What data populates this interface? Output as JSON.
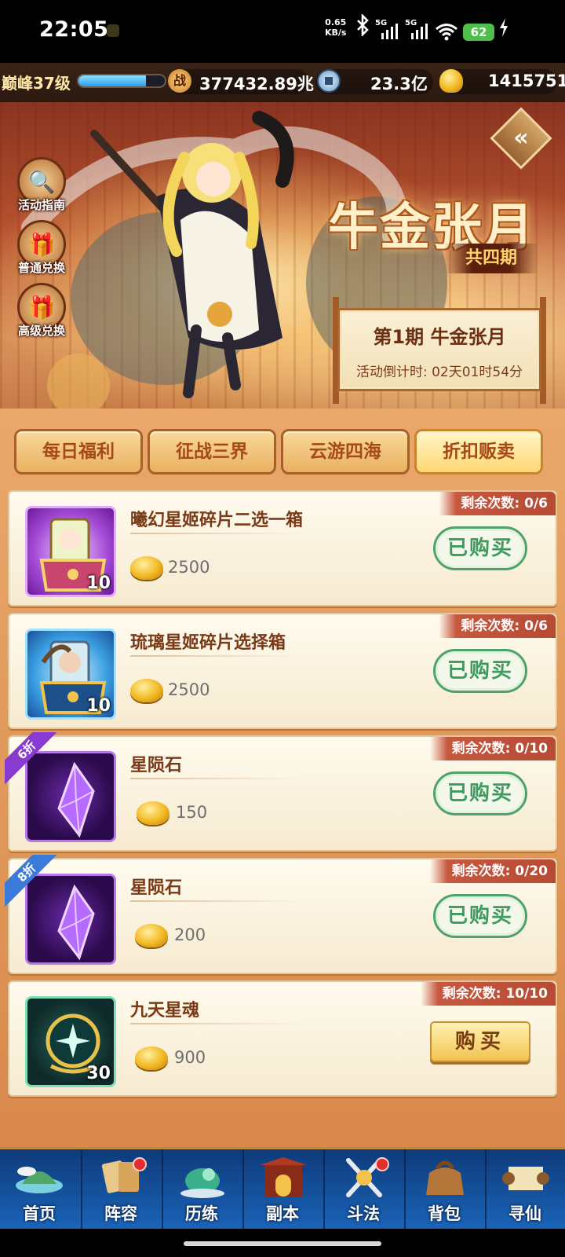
{
  "status_bar": {
    "time": "22:05",
    "net_speed_value": "0.65",
    "net_speed_unit": "KB/s",
    "sim1": "5G",
    "sim2": "5G",
    "battery": "62"
  },
  "resources": {
    "level": "巅峰37级",
    "exp_fraction": 0.78,
    "power": "377432.89兆",
    "copper": "23.3亿",
    "gold": "1415751",
    "power_icon_glyph": "战"
  },
  "side_buttons": [
    {
      "label": "活动指南",
      "icon": "magnifier-icon",
      "glyph": "🔍"
    },
    {
      "label": "普通兑换",
      "icon": "gift-box-icon",
      "glyph": "🎁"
    },
    {
      "label": "高级兑换",
      "icon": "gift-icon",
      "glyph": "🎁"
    }
  ],
  "back_glyph": "«",
  "event": {
    "title": "牛金张月",
    "total_periods": "共四期",
    "current_period": "第1期  牛金张月",
    "countdown": "活动倒计时: 02天01时54分"
  },
  "tabs": [
    {
      "label": "每日福利",
      "active": false
    },
    {
      "label": "征战三界",
      "active": false
    },
    {
      "label": "云游四海",
      "active": false
    },
    {
      "label": "折扣贩卖",
      "active": true
    }
  ],
  "items": [
    {
      "name": "曦幻星姬碎片二选一箱",
      "price": "2500",
      "remaining": "剩余次数: 0/6",
      "count": "10",
      "status": "已购买",
      "discount": ""
    },
    {
      "name": "琉璃星姬碎片选择箱",
      "price": "2500",
      "remaining": "剩余次数: 0/6",
      "count": "10",
      "status": "已购买",
      "discount": ""
    },
    {
      "name": "星陨石",
      "price": "150",
      "remaining": "剩余次数: 0/10",
      "count": "",
      "status": "已购买",
      "discount": "6折"
    },
    {
      "name": "星陨石",
      "price": "200",
      "remaining": "剩余次数: 0/20",
      "count": "",
      "status": "已购买",
      "discount": "8折"
    },
    {
      "name": "九天星魂",
      "price": "900",
      "remaining": "剩余次数: 10/10",
      "count": "30",
      "status": "购买",
      "discount": ""
    }
  ],
  "nav": [
    {
      "label": "首页",
      "icon": "island-icon",
      "badge": false
    },
    {
      "label": "阵容",
      "icon": "cards-icon",
      "badge": true
    },
    {
      "label": "历练",
      "icon": "dragon-icon",
      "badge": false
    },
    {
      "label": "副本",
      "icon": "gate-icon",
      "badge": false
    },
    {
      "label": "斗法",
      "icon": "swords-icon",
      "badge": true
    },
    {
      "label": "背包",
      "icon": "bag-icon",
      "badge": false
    },
    {
      "label": "寻仙",
      "icon": "scroll-icon",
      "badge": false
    }
  ],
  "colors": {
    "accent_red": "#c65840",
    "bought_green": "#3e9a5e",
    "gold": "#f2b720",
    "nav_blue": "#1a64b8"
  }
}
